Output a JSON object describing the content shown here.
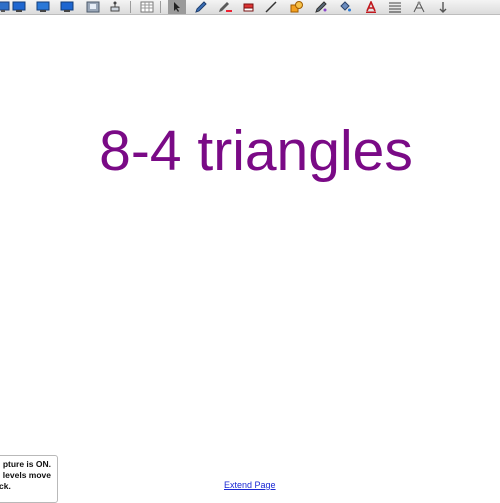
{
  "toolbar": {
    "tools": [
      {
        "name": "display-icon"
      },
      {
        "name": "monitor-icon"
      },
      {
        "name": "monitor-icon"
      },
      {
        "name": "monitor-icon"
      },
      {
        "name": "document-camera-icon"
      },
      {
        "name": "screen-capture-icon"
      },
      {
        "name": "table-icon"
      },
      {
        "name": "select-arrow-icon",
        "active": true
      },
      {
        "name": "pen-icon"
      },
      {
        "name": "creative-pen-icon"
      },
      {
        "name": "eraser-icon"
      },
      {
        "name": "line-icon"
      },
      {
        "name": "shape-icon"
      },
      {
        "name": "magic-pen-icon"
      },
      {
        "name": "fill-icon"
      },
      {
        "name": "text-icon"
      },
      {
        "name": "properties-icon"
      },
      {
        "name": "measurement-icon"
      },
      {
        "name": "move-toolbar-icon"
      }
    ]
  },
  "page": {
    "title": "8-4 triangles",
    "title_color": "#7a0a86",
    "extend_link": "Extend Page"
  },
  "notice": {
    "line1": "pture is ON.",
    "line2": "levels move",
    "line3": "ck."
  }
}
